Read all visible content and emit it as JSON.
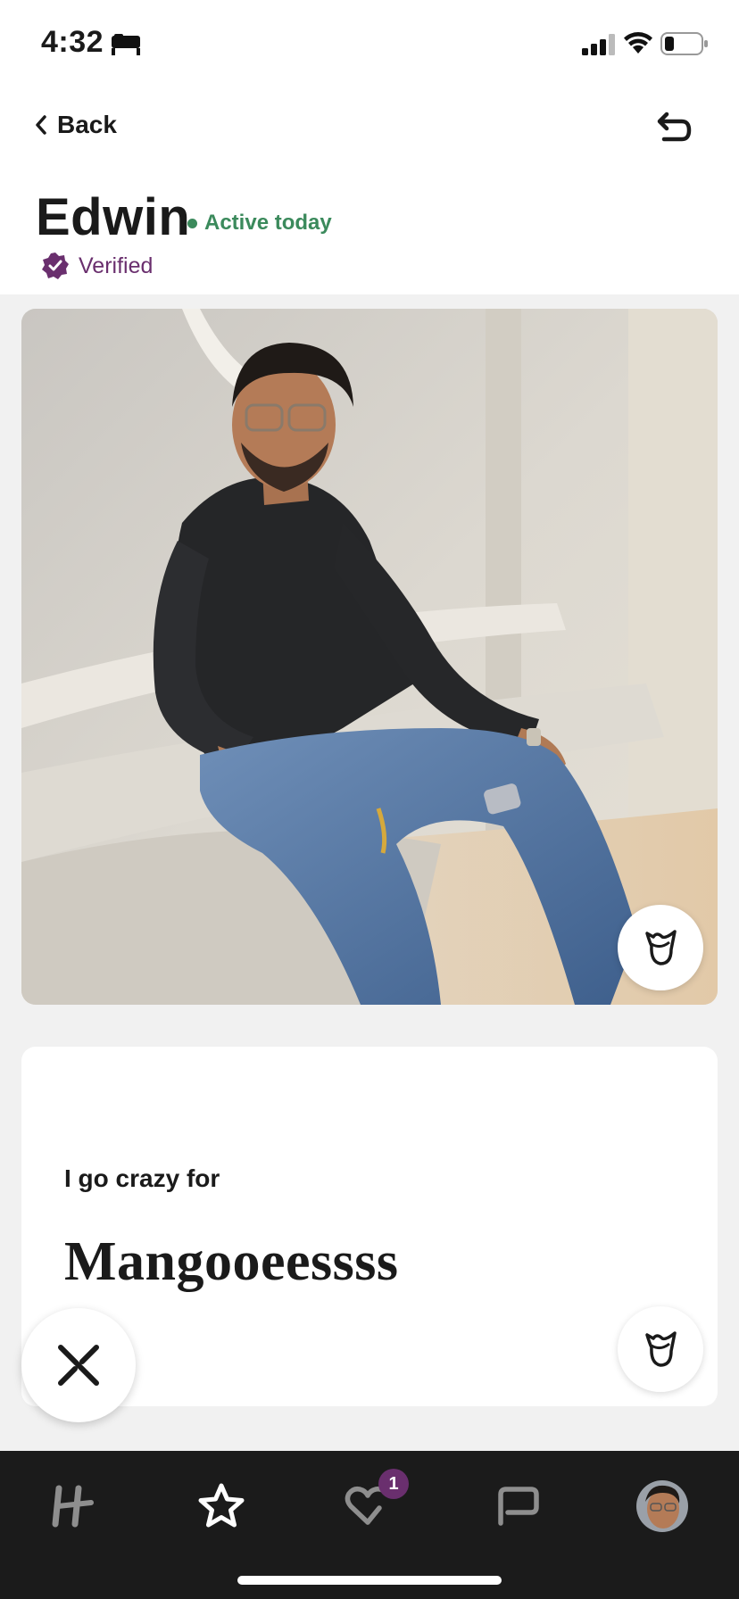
{
  "status_bar": {
    "time": "4:32",
    "icons": [
      "sleep-focus-icon",
      "cellular-signal-icon",
      "wifi-icon",
      "battery-icon"
    ]
  },
  "header": {
    "back_label": "Back",
    "undo_icon": "undo-arrow-icon",
    "name": "Edwin",
    "activity": "Active today",
    "verified_label": "Verified",
    "more_icon": "more-options-icon"
  },
  "photo": {
    "description_icon": "profile-photo",
    "like_icon": "rose-icon"
  },
  "prompt": {
    "question": "I go crazy for",
    "answer": "Mangooeessss",
    "like_icon": "rose-icon"
  },
  "actions": {
    "skip_icon": "skip-x-icon"
  },
  "tab_bar": {
    "tabs": [
      {
        "name": "discover",
        "icon": "hinge-logo-icon"
      },
      {
        "name": "standouts",
        "icon": "star-icon"
      },
      {
        "name": "likes-you",
        "icon": "heart-icon",
        "badge": "1"
      },
      {
        "name": "matches",
        "icon": "chat-bubble-icon"
      },
      {
        "name": "profile",
        "icon": "avatar"
      }
    ]
  },
  "colors": {
    "active_green": "#3b8a5c",
    "verified_purple": "#6a2f6e",
    "tab_bar_bg": "#1b1b1b",
    "page_bg": "#f1f1f1"
  }
}
